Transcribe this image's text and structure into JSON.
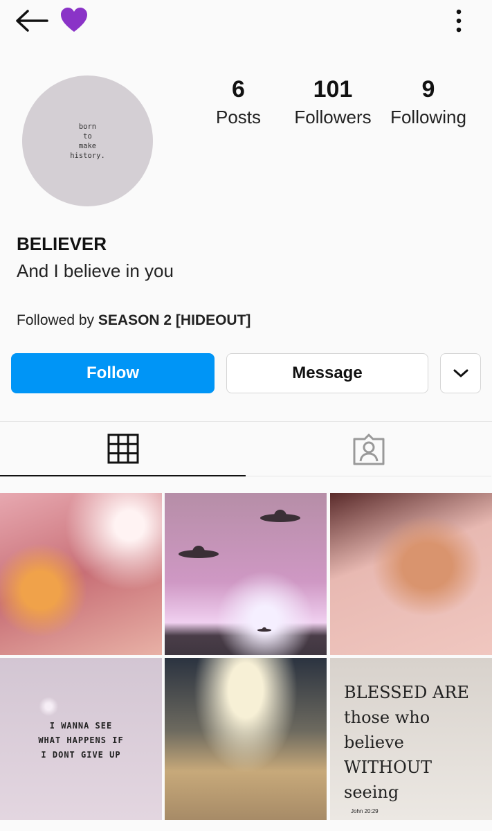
{
  "topbar": {
    "back_icon": "arrow-left-icon",
    "emoji_icon": "purple-heart-icon",
    "more_icon": "vertical-dots-icon"
  },
  "profile": {
    "avatar_text": "born\nto\nmake\nhistory.",
    "name": "BELIEVER",
    "bio": "And I believe in you",
    "followed_by_prefix": "Followed by ",
    "followed_by_name": "SEASON 2 [HIDEOUT]"
  },
  "stats": {
    "posts_count": "6",
    "posts_label": "Posts",
    "followers_count": "101",
    "followers_label": "Followers",
    "following_count": "9",
    "following_label": "Following"
  },
  "actions": {
    "follow_label": "Follow",
    "message_label": "Message",
    "more_icon": "chevron-down-icon"
  },
  "colors": {
    "follow_blue": "#0095f6",
    "heart_purple": "#8a33c7"
  },
  "tabs": [
    {
      "icon": "grid-icon",
      "selected": true
    },
    {
      "icon": "tagged-person-icon",
      "selected": false
    }
  ],
  "posts": {
    "quote_text": "I WANNA SEE\nWHAT HAPPENS IF\nI DONT GIVE UP",
    "script_text": "BLESSED ARE\nthose who\nbelieve\nWITHOUT\nseeing",
    "script_caption": "John 20:29"
  }
}
